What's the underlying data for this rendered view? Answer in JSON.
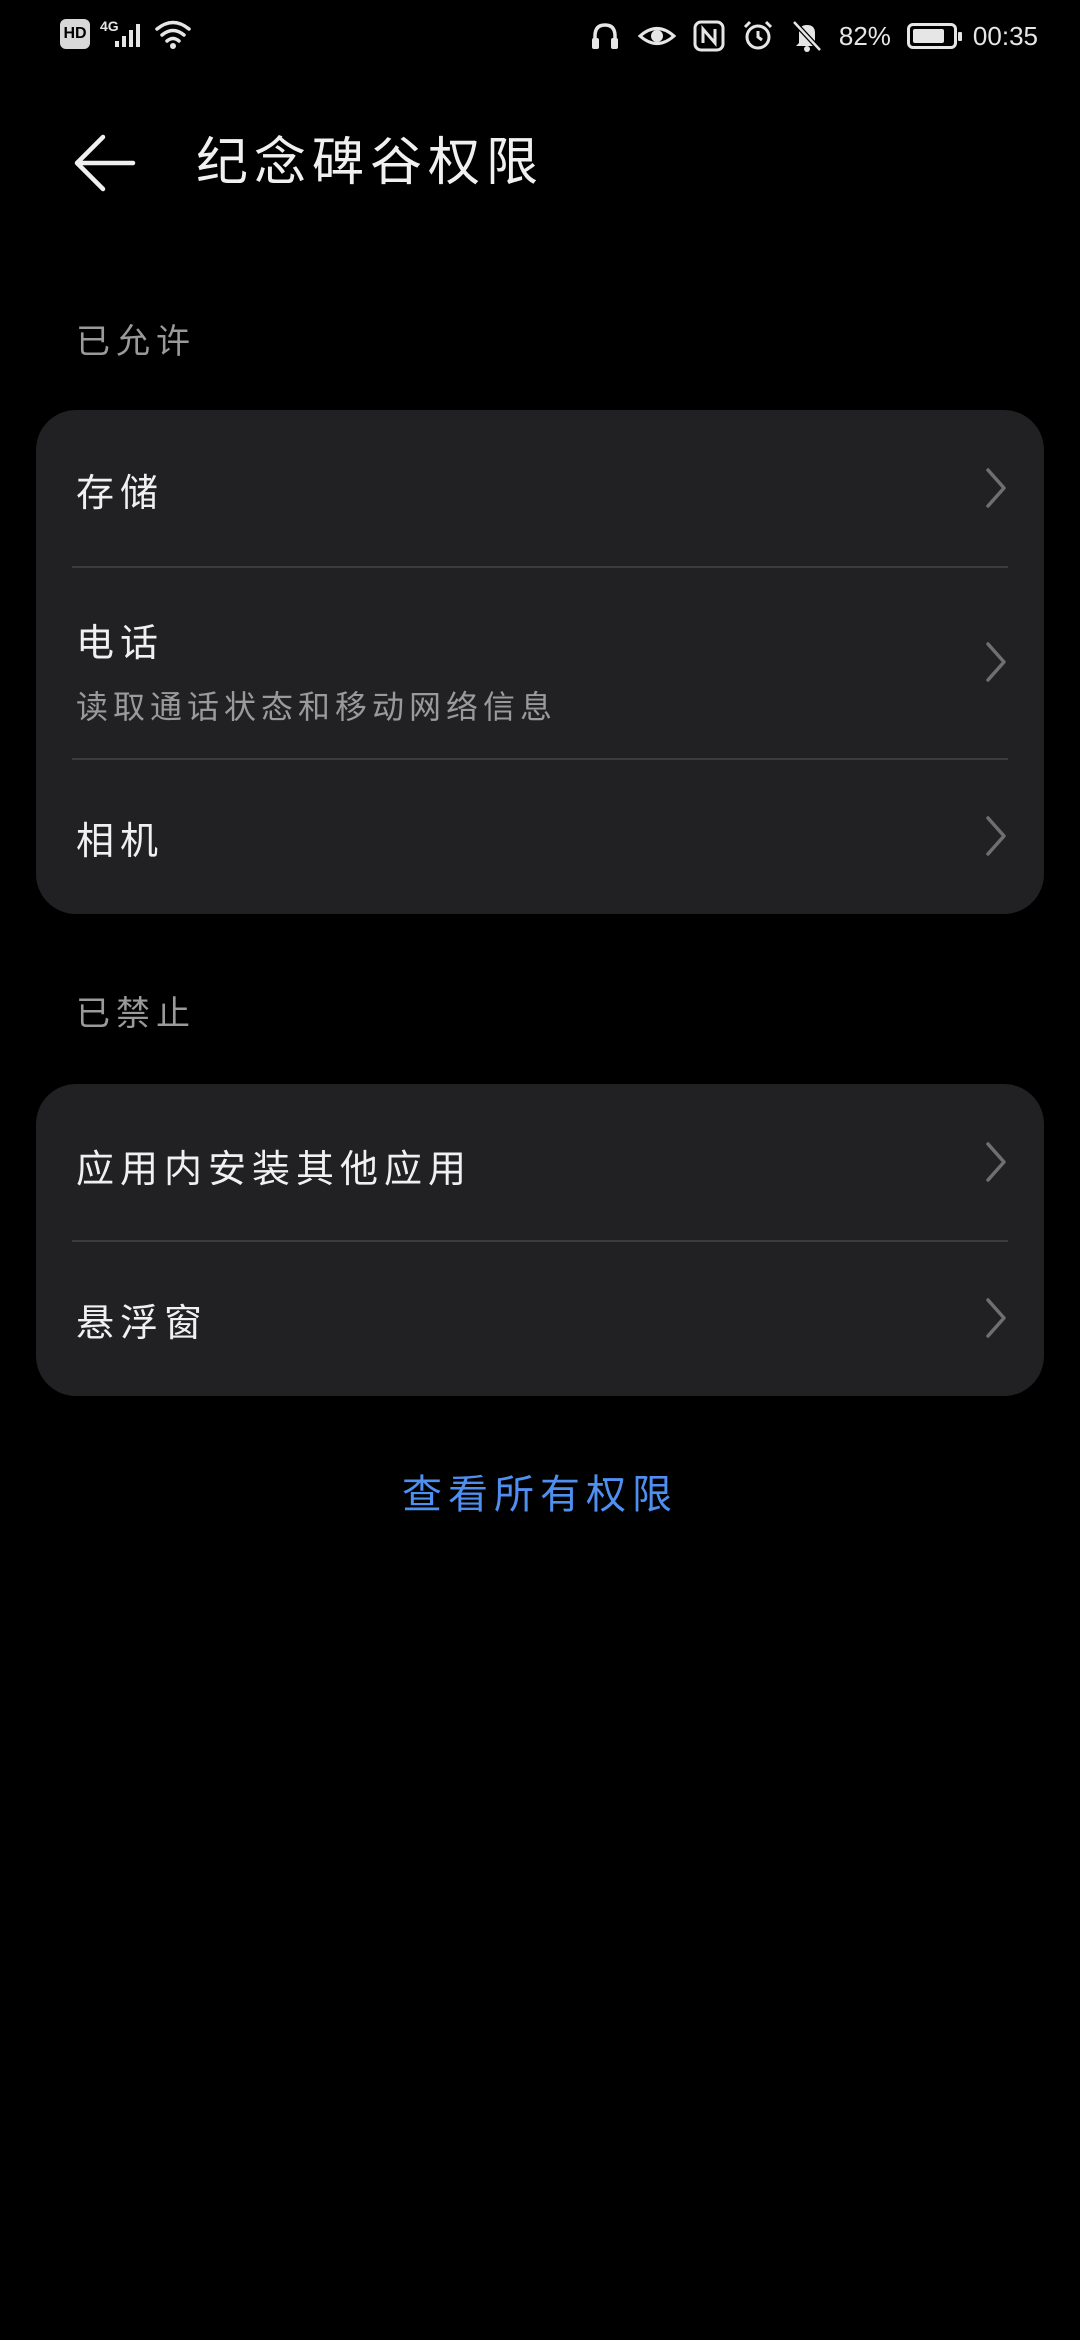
{
  "status_bar": {
    "hd_label": "HD",
    "network_type": "4G",
    "battery_percent": "82%",
    "battery_level": 0.82,
    "time": "00:35",
    "icons": [
      "signal-icon",
      "wifi-icon",
      "headphones-icon",
      "eye-icon",
      "nfc-icon",
      "alarm-icon",
      "mute-icon",
      "battery-icon"
    ]
  },
  "header": {
    "title": "纪念碑谷权限",
    "back_icon": "back-arrow-icon"
  },
  "allowed": {
    "header": "已允许",
    "items": [
      {
        "title": "存储",
        "subtitle": ""
      },
      {
        "title": "电话",
        "subtitle": "读取通话状态和移动网络信息"
      },
      {
        "title": "相机",
        "subtitle": ""
      }
    ]
  },
  "denied": {
    "header": "已禁止",
    "items": [
      {
        "title": "应用内安装其他应用",
        "subtitle": ""
      },
      {
        "title": "悬浮窗",
        "subtitle": ""
      }
    ]
  },
  "footer": {
    "view_all_label": "查看所有权限",
    "link_color": "#4f8ff0"
  }
}
